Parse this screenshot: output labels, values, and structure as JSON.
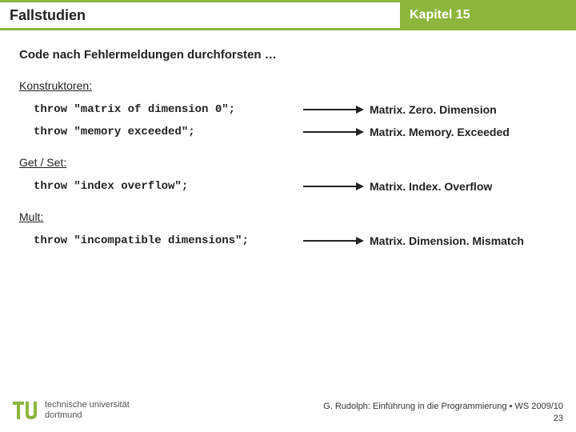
{
  "header": {
    "left": "Fallstudien",
    "right": "Kapitel 15"
  },
  "subtitle": "Code nach Fehlermeldungen durchforsten …",
  "sections": {
    "konstruktoren": {
      "label": "Konstruktoren:",
      "rows": [
        {
          "code": "throw \"matrix of dimension 0\";",
          "result": "Matrix. Zero. Dimension"
        },
        {
          "code": "throw \"memory exceeded\";",
          "result": "Matrix. Memory. Exceeded"
        }
      ]
    },
    "getset": {
      "label": "Get / Set:",
      "rows": [
        {
          "code": "throw \"index overflow\";",
          "result": "Matrix. Index. Overflow"
        }
      ]
    },
    "mult": {
      "label": "Mult:",
      "rows": [
        {
          "code": "throw \"incompatible dimensions\";",
          "result": "Matrix. Dimension. Mismatch"
        }
      ]
    }
  },
  "footer": {
    "uni1": "technische universität",
    "uni2": "dortmund",
    "credit": "G. Rudolph: Einführung in die Programmierung ▪ WS 2009/10",
    "page": "23"
  }
}
